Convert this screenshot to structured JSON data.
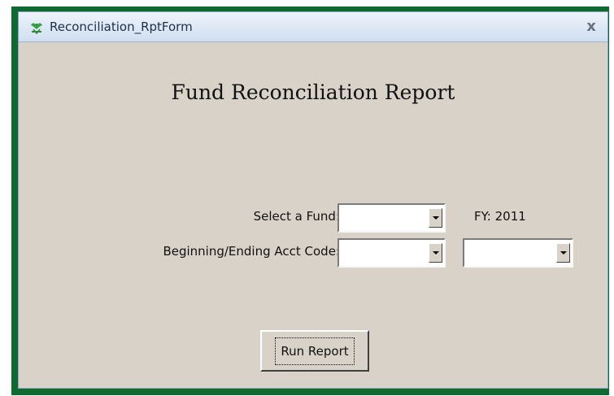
{
  "window": {
    "title": "Reconciliation_RptForm",
    "close_label": "x"
  },
  "form": {
    "heading": "Fund Reconciliation Report",
    "fund": {
      "label": "Select a Fund:",
      "value": ""
    },
    "fy": {
      "label": "FY:",
      "value": "2011"
    },
    "acct_code": {
      "label": "Beginning/Ending Acct Code:",
      "begin_value": "",
      "end_value": ""
    },
    "run_button_label": "Run Report"
  },
  "icons": {
    "app": "reconciliation-app-icon",
    "close": "close-icon",
    "dropdown": "chevron-down-icon"
  },
  "colors": {
    "frame_green": "#0f6a32",
    "form_background": "#d8d2c8",
    "titlebar": "#dde8f5"
  }
}
